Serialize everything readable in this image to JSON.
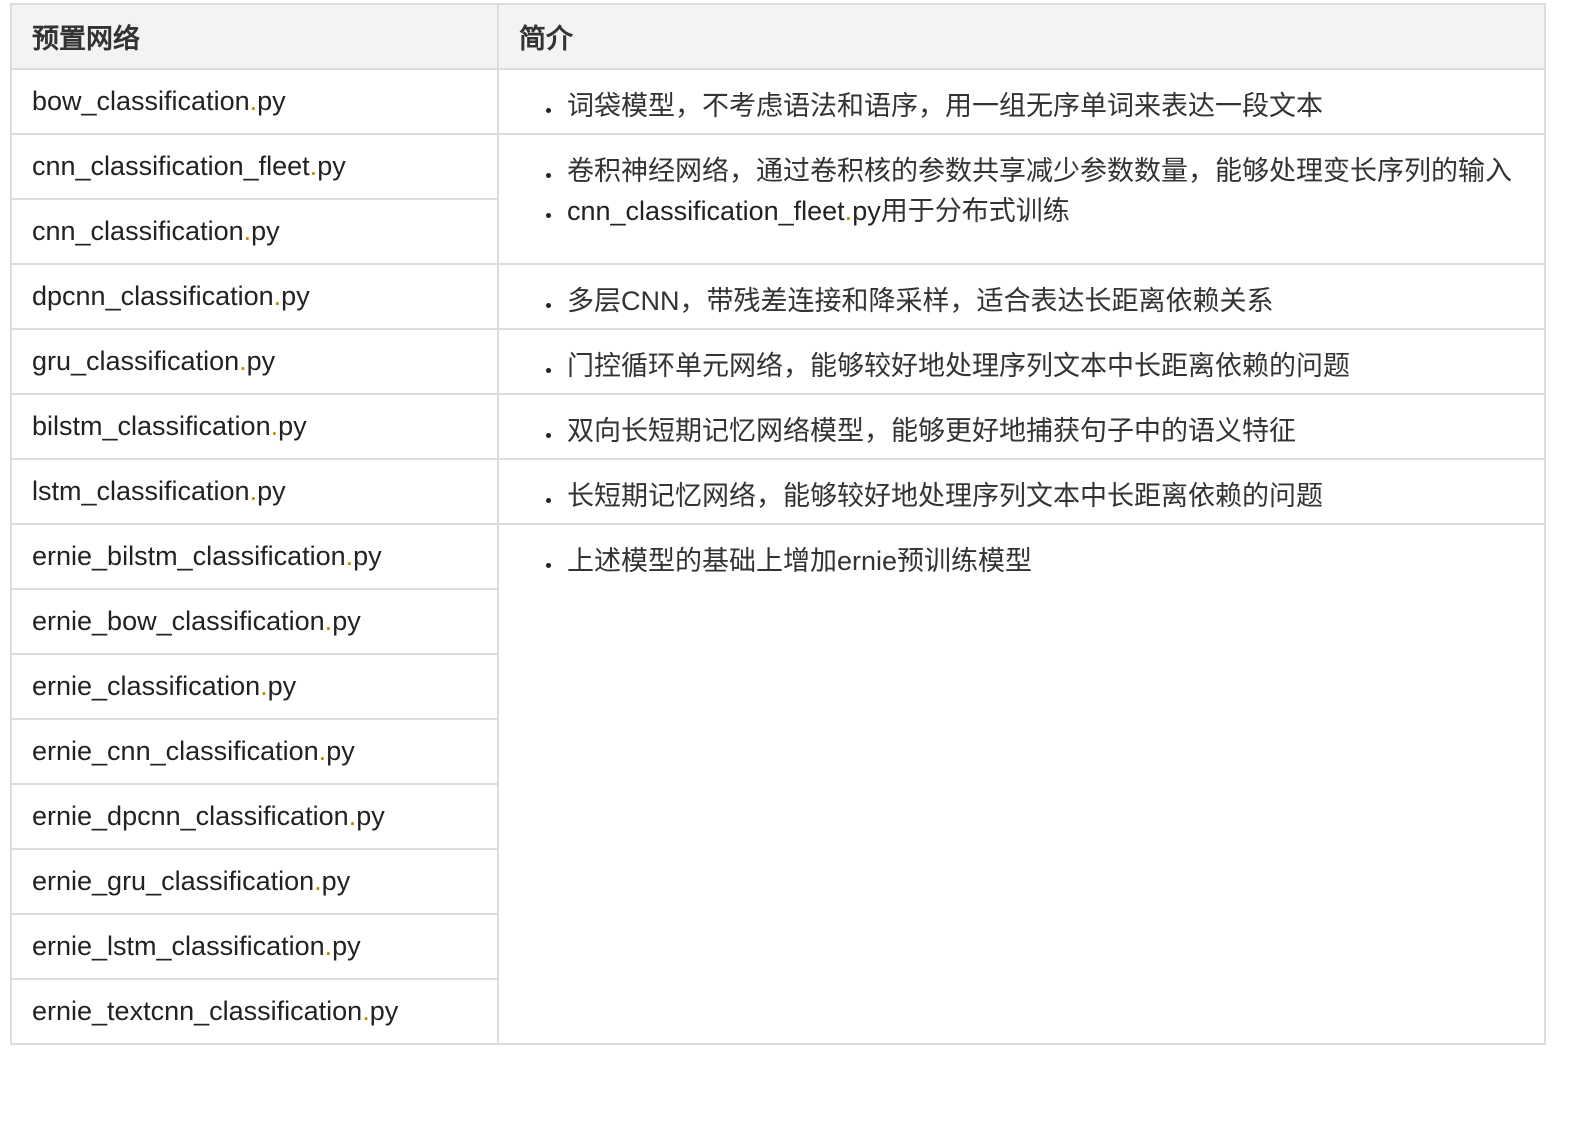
{
  "table": {
    "headers": [
      "预置网络",
      "简介"
    ],
    "rows": [
      {
        "files": [
          {
            "base": "bow_classification",
            "ext": "py"
          }
        ],
        "desc": [
          "词袋模型，不考虑语法和语序，用一组无序单词来表达一段文本"
        ]
      },
      {
        "files": [
          {
            "base": "cnn_classification_fleet",
            "ext": "py"
          },
          {
            "base": "cnn_classification",
            "ext": "py"
          }
        ],
        "desc": [
          "卷积神经网络，通过卷积核的参数共享减少参数数量，能够处理变长序列的输入",
          {
            "code": "cnn_classification_fleet",
            "ext": "py",
            "text": "用于分布式训练"
          }
        ]
      },
      {
        "files": [
          {
            "base": "dpcnn_classification",
            "ext": "py"
          }
        ],
        "desc": [
          "多层CNN，带残差连接和降采样，适合表达长距离依赖关系"
        ]
      },
      {
        "files": [
          {
            "base": "gru_classification",
            "ext": "py"
          }
        ],
        "desc": [
          "门控循环单元网络，能够较好地处理序列文本中长距离依赖的问题"
        ]
      },
      {
        "files": [
          {
            "base": "bilstm_classification",
            "ext": "py"
          }
        ],
        "desc": [
          "双向长短期记忆网络模型，能够更好地捕获句子中的语义特征"
        ]
      },
      {
        "files": [
          {
            "base": "lstm_classification",
            "ext": "py"
          }
        ],
        "desc": [
          "长短期记忆网络，能够较好地处理序列文本中长距离依赖的问题"
        ]
      },
      {
        "files": [
          {
            "base": "ernie_bilstm_classification",
            "ext": "py"
          },
          {
            "base": "ernie_bow_classification",
            "ext": "py"
          },
          {
            "base": "ernie_classification",
            "ext": "py"
          },
          {
            "base": "ernie_cnn_classification",
            "ext": "py"
          },
          {
            "base": "ernie_dpcnn_classification",
            "ext": "py"
          },
          {
            "base": "ernie_gru_classification",
            "ext": "py"
          },
          {
            "base": "ernie_lstm_classification",
            "ext": "py"
          },
          {
            "base": "ernie_textcnn_classification",
            "ext": "py"
          }
        ],
        "desc": [
          "上述模型的基础上增加ernie预训练模型"
        ]
      }
    ]
  },
  "colors": {
    "border": "#dcdcdc",
    "header_bg": "#f3f3f3",
    "dot": "#b58900",
    "text": "#222222"
  }
}
